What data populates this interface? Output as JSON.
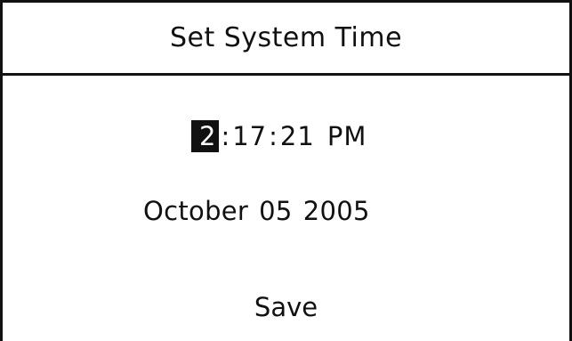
{
  "dialog": {
    "title": "Set System Time"
  },
  "time": {
    "hour": "2",
    "minute": "17",
    "second": "21",
    "separator": ":",
    "period": "PM",
    "selected_field": "hour"
  },
  "date": {
    "month": "October",
    "day": "05",
    "year": "2005"
  },
  "actions": {
    "save_label": "Save"
  },
  "colors": {
    "foreground": "#111111",
    "background": "#ffffff",
    "selection_background": "#111111",
    "selection_text": "#ffffff"
  }
}
